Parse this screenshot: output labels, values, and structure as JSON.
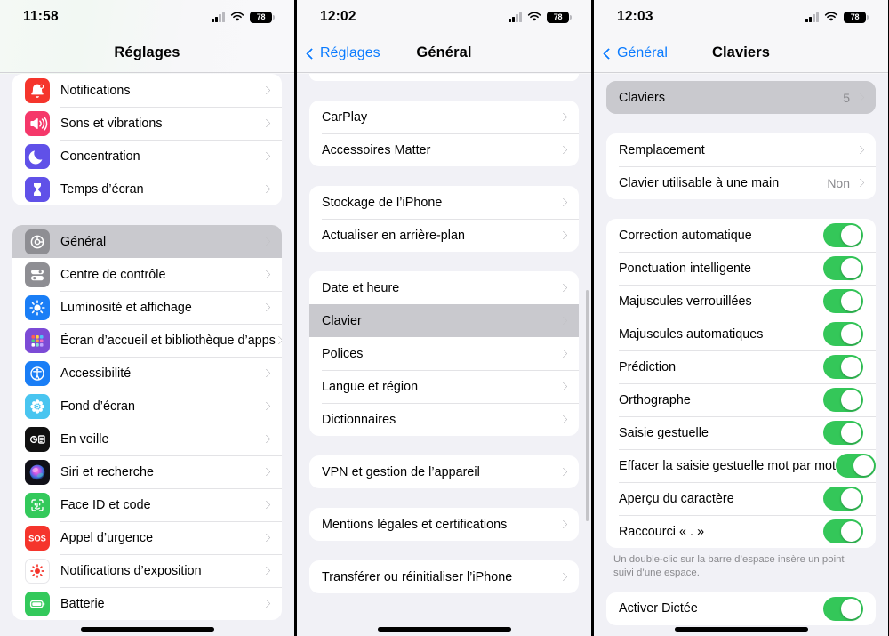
{
  "colors": {
    "accent_blue": "#0a7bff",
    "toggle_green": "#34c759",
    "selected_row": "#c9c9ce",
    "page_bg": "#f1f1f6",
    "card_bg": "#ffffff",
    "secondary_text": "#8a8a8e"
  },
  "panels": [
    {
      "id": "settings-root",
      "statusbar": {
        "time": "11:58",
        "battery": "78"
      },
      "nav": {
        "title": "Réglages",
        "back": null
      },
      "groups": [
        {
          "type": "icon-list",
          "rows": [
            {
              "label": "Notifications",
              "icon": "bell-icon",
              "chevron": true
            },
            {
              "label": "Sons et vibrations",
              "icon": "speaker-icon",
              "chevron": true
            },
            {
              "label": "Concentration",
              "icon": "moon-icon",
              "chevron": true
            },
            {
              "label": "Temps d’écran",
              "icon": "hourglass-icon",
              "chevron": true
            }
          ]
        },
        {
          "type": "icon-list",
          "rows": [
            {
              "label": "Général",
              "icon": "gear-icon",
              "chevron": true,
              "highlighted": true
            },
            {
              "label": "Centre de contrôle",
              "icon": "sliders-icon",
              "chevron": true
            },
            {
              "label": "Luminosité et affichage",
              "icon": "brightness-icon",
              "chevron": true
            },
            {
              "label": "Écran d’accueil et bibliothèque d’apps",
              "icon": "app-grid-icon",
              "chevron": true
            },
            {
              "label": "Accessibilité",
              "icon": "accessibility-icon",
              "chevron": true
            },
            {
              "label": "Fond d’écran",
              "icon": "wallpaper-flower-icon",
              "chevron": true
            },
            {
              "label": "En veille",
              "icon": "standby-icon",
              "chevron": true
            },
            {
              "label": "Siri et recherche",
              "icon": "siri-icon",
              "chevron": true
            },
            {
              "label": "Face ID et code",
              "icon": "face-id-icon",
              "chevron": true
            },
            {
              "label": "Appel d’urgence",
              "icon": "sos-icon",
              "chevron": true
            },
            {
              "label": "Notifications d’exposition",
              "icon": "exposure-icon",
              "chevron": true
            },
            {
              "label": "Batterie",
              "icon": "battery-icon",
              "chevron": true
            }
          ]
        }
      ]
    },
    {
      "id": "general",
      "statusbar": {
        "time": "12:02",
        "battery": "78"
      },
      "nav": {
        "title": "Général",
        "back": "Réglages"
      },
      "groups": [
        {
          "type": "partial",
          "rows": []
        },
        {
          "type": "plain-list",
          "rows": [
            {
              "label": "CarPlay",
              "chevron": true
            },
            {
              "label": "Accessoires Matter",
              "chevron": true
            }
          ]
        },
        {
          "type": "plain-list",
          "rows": [
            {
              "label": "Stockage de l’iPhone",
              "chevron": true
            },
            {
              "label": "Actualiser en arrière-plan",
              "chevron": true
            }
          ]
        },
        {
          "type": "plain-list",
          "rows": [
            {
              "label": "Date et heure",
              "chevron": true
            },
            {
              "label": "Clavier",
              "chevron": true,
              "highlighted": true
            },
            {
              "label": "Polices",
              "chevron": true
            },
            {
              "label": "Langue et région",
              "chevron": true
            },
            {
              "label": "Dictionnaires",
              "chevron": true
            }
          ]
        },
        {
          "type": "plain-list",
          "rows": [
            {
              "label": "VPN et gestion de l’appareil",
              "chevron": true
            }
          ]
        },
        {
          "type": "plain-list",
          "rows": [
            {
              "label": "Mentions légales et certifications",
              "chevron": true
            }
          ]
        },
        {
          "type": "plain-list",
          "rows": [
            {
              "label": "Transférer ou réinitialiser l’iPhone",
              "chevron": true
            }
          ]
        }
      ]
    },
    {
      "id": "keyboards",
      "statusbar": {
        "time": "12:03",
        "battery": "78"
      },
      "nav": {
        "title": "Claviers",
        "back": "Général"
      },
      "groups": [
        {
          "type": "plain-list",
          "selected": true,
          "rows": [
            {
              "label": "Claviers",
              "value": "5",
              "chevron": true,
              "highlighted": true
            }
          ]
        },
        {
          "type": "plain-list",
          "rows": [
            {
              "label": "Remplacement",
              "chevron": true
            },
            {
              "label": "Clavier utilisable à une main",
              "value": "Non",
              "chevron": true
            }
          ]
        },
        {
          "type": "toggle-list",
          "footnote": "Un double-clic sur la barre d’espace insère un point suivi d’une espace.",
          "rows": [
            {
              "label": "Correction automatique",
              "toggle": true
            },
            {
              "label": "Ponctuation intelligente",
              "toggle": true
            },
            {
              "label": "Majuscules verrouillées",
              "toggle": true
            },
            {
              "label": "Majuscules automatiques",
              "toggle": true
            },
            {
              "label": "Prédiction",
              "toggle": true
            },
            {
              "label": "Orthographe",
              "toggle": true
            },
            {
              "label": "Saisie gestuelle",
              "toggle": true
            },
            {
              "label": "Effacer la saisie gestuelle mot par mot",
              "toggle": true
            },
            {
              "label": "Aperçu du caractère",
              "toggle": true
            },
            {
              "label": "Raccourci « . »",
              "toggle": true
            }
          ]
        },
        {
          "type": "toggle-list",
          "rows": [
            {
              "label": "Activer Dictée",
              "toggle": true
            }
          ]
        }
      ]
    }
  ]
}
